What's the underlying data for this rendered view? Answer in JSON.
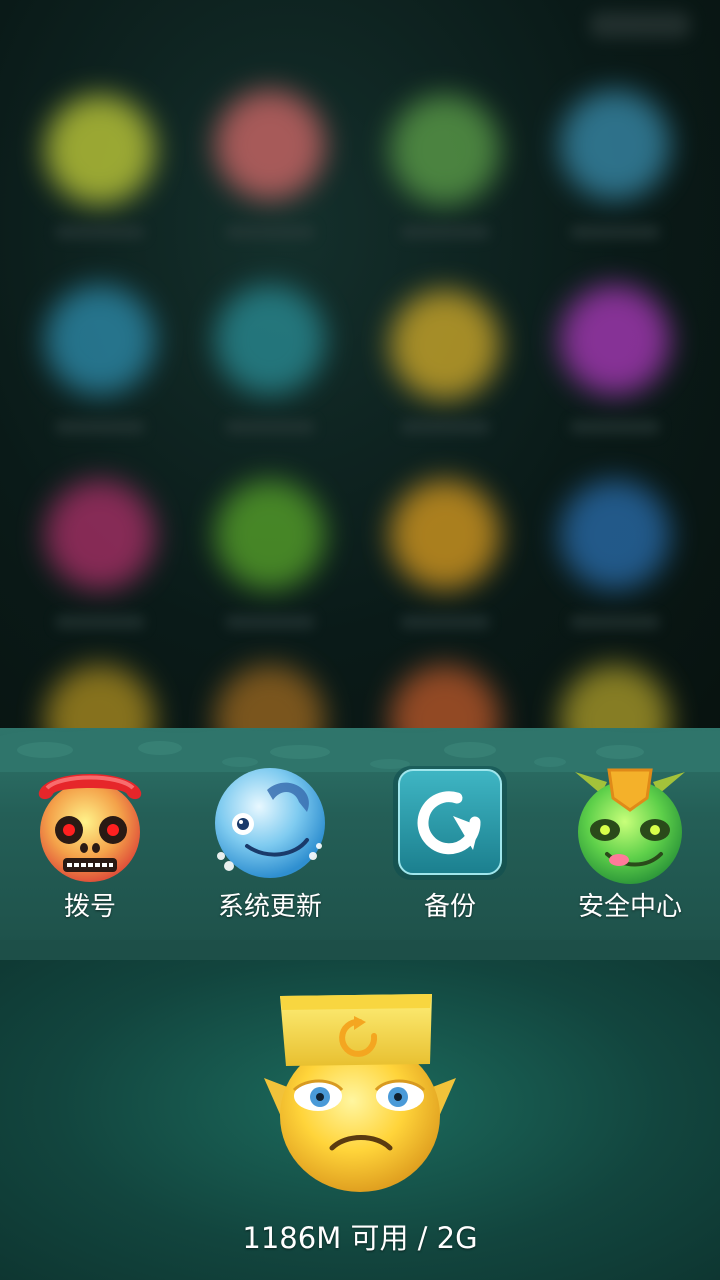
{
  "apps": [
    {
      "label": "拨号",
      "icon": "skull-phone-icon"
    },
    {
      "label": "系统更新",
      "icon": "blue-fish-update-icon"
    },
    {
      "label": "备份",
      "icon": "backup-refresh-icon"
    },
    {
      "label": "安全中心",
      "icon": "green-alien-shield-icon"
    }
  ],
  "cleaner": {
    "icon": "sad-face-cleaner-icon",
    "memory_text": "1186M 可用 / 2G"
  },
  "colors": {
    "dock": "#2a6b62",
    "cleaner_bg": "#12453e",
    "label_text": "#ffffff"
  }
}
